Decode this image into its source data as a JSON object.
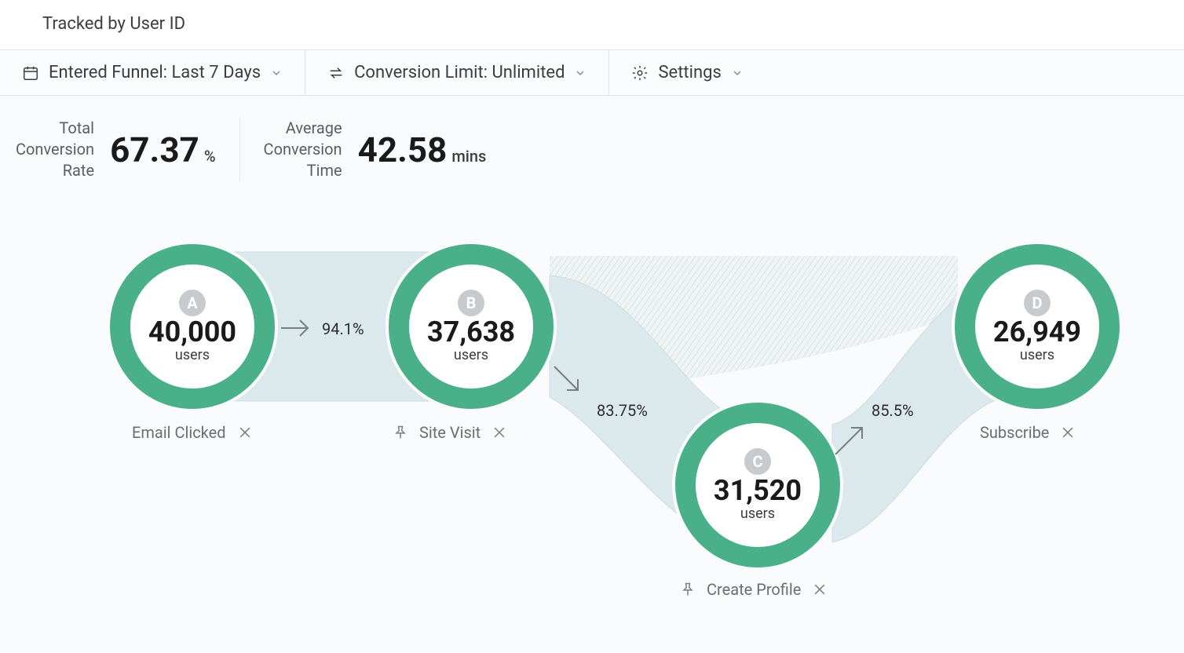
{
  "title": "Tracked by User ID",
  "toolbar": {
    "date_range_label": "Entered Funnel: Last 7 Days",
    "conversion_limit_label": "Conversion Limit: Unlimited",
    "settings_label": "Settings"
  },
  "metrics": {
    "total_label_l1": "Total",
    "total_label_l2": "Conversion",
    "total_label_l3": "Rate",
    "total_value": "67.37",
    "total_unit": "%",
    "avg_label_l1": "Average",
    "avg_label_l2": "Conversion",
    "avg_label_l3": "Time",
    "avg_value": "42.58",
    "avg_unit": "mins"
  },
  "nodes": {
    "a": {
      "letter": "A",
      "count": "40,000",
      "users": "users",
      "label": "Email Clicked"
    },
    "b": {
      "letter": "B",
      "count": "37,638",
      "users": "users",
      "label": "Site Visit"
    },
    "c": {
      "letter": "C",
      "count": "31,520",
      "users": "users",
      "label": "Create Profile"
    },
    "d": {
      "letter": "D",
      "count": "26,949",
      "users": "users",
      "label": "Subscribe"
    }
  },
  "conversions": {
    "ab": "94.1%",
    "bc": "83.75%",
    "cd": "85.5%"
  },
  "chart_data": {
    "type": "funnel",
    "title": "Tracked by User ID",
    "metric": "users",
    "total_conversion_rate_pct": 67.37,
    "average_conversion_time_mins": 42.58,
    "steps": [
      {
        "id": "A",
        "label": "Email Clicked",
        "users": 40000
      },
      {
        "id": "B",
        "label": "Site Visit",
        "users": 37638
      },
      {
        "id": "C",
        "label": "Create Profile",
        "users": 31520
      },
      {
        "id": "D",
        "label": "Subscribe",
        "users": 26949
      }
    ],
    "step_conversion_rates_pct": [
      94.1,
      83.75,
      85.5
    ]
  }
}
